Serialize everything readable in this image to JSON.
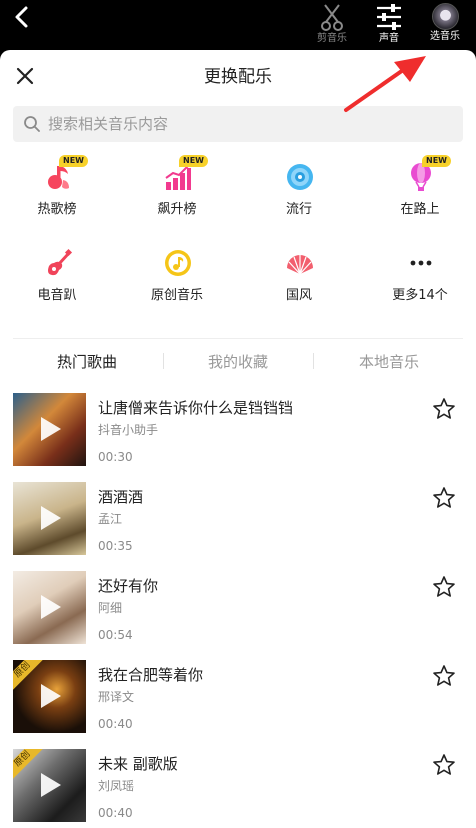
{
  "topbar": {
    "tools": [
      {
        "label": "剪音乐",
        "icon": "scissors-icon"
      },
      {
        "label": "声音",
        "icon": "sliders-icon"
      },
      {
        "label": "选音乐",
        "icon": "avatar"
      }
    ]
  },
  "sheet": {
    "title": "更换配乐",
    "search_placeholder": "搜索相关音乐内容"
  },
  "badge_new": "NEW",
  "categories": [
    {
      "label": "热歌榜",
      "icon": "hot-song-icon",
      "new": true,
      "color": "#f6455e"
    },
    {
      "label": "飙升榜",
      "icon": "rising-chart-icon",
      "new": true,
      "color": "#f23a8f"
    },
    {
      "label": "流行",
      "icon": "vinyl-icon",
      "new": false,
      "color": "#45b6f0"
    },
    {
      "label": "在路上",
      "icon": "balloon-icon",
      "new": true,
      "color": "#e94bd1"
    },
    {
      "label": "电音趴",
      "icon": "guitar-icon",
      "new": false,
      "color": "#f0445a"
    },
    {
      "label": "原创音乐",
      "icon": "music-disc-icon",
      "new": false,
      "color": "#f5c518"
    },
    {
      "label": "国风",
      "icon": "fan-icon",
      "new": false,
      "color": "#f25f6e"
    },
    {
      "label": "更多14个",
      "icon": "more-icon",
      "new": false,
      "color": "#222222"
    }
  ],
  "tabs": [
    {
      "label": "热门歌曲",
      "active": true
    },
    {
      "label": "我的收藏",
      "active": false
    },
    {
      "label": "本地音乐",
      "active": false
    }
  ],
  "original_badge": "原创",
  "songs": [
    {
      "title": "让唐僧来告诉你什么是铛铛铛",
      "artist": "抖音小助手",
      "duration": "00:30",
      "original": false
    },
    {
      "title": "酒酒酒",
      "artist": "孟江",
      "duration": "00:35",
      "original": false
    },
    {
      "title": "还好有你",
      "artist": "阿细",
      "duration": "00:54",
      "original": false
    },
    {
      "title": "我在合肥等着你",
      "artist": "邢译文",
      "duration": "00:40",
      "original": true
    },
    {
      "title": "未来 副歌版",
      "artist": "刘凤瑶",
      "duration": "00:40",
      "original": true
    }
  ],
  "colors": {
    "accent_red": "#ef2d2d",
    "badge_yellow": "#f7d12a"
  }
}
